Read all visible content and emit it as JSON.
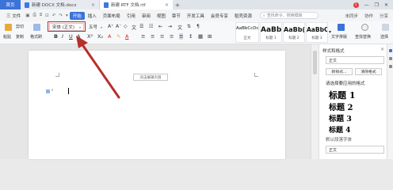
{
  "tabs": {
    "home": "首页",
    "doc1": "新建 DOCX 文档.docx",
    "doc2": "新建 RTF 文档.rtf",
    "plus": "+",
    "close": "×",
    "badge": "1",
    "minimize": "—",
    "restore": "❐",
    "win_close": "✕"
  },
  "menu": {
    "file": "三 文件",
    "items": [
      "开始",
      "插入",
      "页面布局",
      "引用",
      "审阅",
      "视图",
      "章节",
      "开发工具",
      "会员专享",
      "稻壳资源"
    ],
    "active": "开始",
    "search_placeholder": "查找命令、搜索模板",
    "right": [
      "未同步",
      "协作",
      "分享"
    ]
  },
  "ribbon": {
    "cut": "剪切",
    "paste": "粘贴",
    "copy": "复制",
    "format_painter": "格式刷",
    "font_name": "宋体 (正文)",
    "font_size": "五号",
    "styles": [
      {
        "sample": "AaBbCcDd",
        "label": "正文"
      },
      {
        "sample": "AaBb",
        "label": "标题 1"
      },
      {
        "sample": "AaBb(",
        "label": "标题 2"
      },
      {
        "sample": "AaBbC",
        "label": "标题 3"
      }
    ],
    "text_layout": "文字排版",
    "find_replace": "查找替换",
    "select": "选择"
  },
  "document": {
    "header_tip": "双击编辑页眉"
  },
  "pane": {
    "title": "样式和格式",
    "current": "正文",
    "new_style": "新样式...",
    "clear_format": "清除格式",
    "apply_label": "请选择要应用的格式",
    "headings": [
      "标题 1",
      "标题 2",
      "标题 3",
      "标题 4"
    ],
    "default_font_label": "默认段落字体",
    "show_value": "正文"
  },
  "colors": {
    "accent": "#3b73d8",
    "highlight": "#d42020",
    "arrow": "#b5302a"
  }
}
